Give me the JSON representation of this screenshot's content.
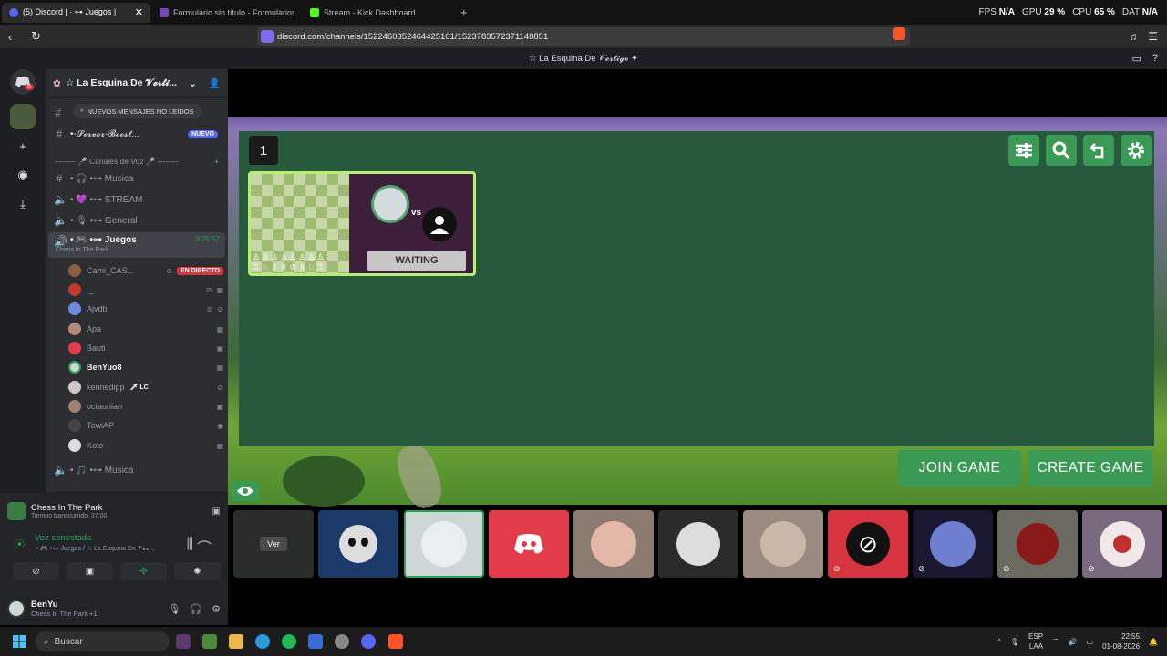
{
  "browser": {
    "tabs": [
      {
        "label": "(5) Discord | · ⊶ Juegos |",
        "favicon_color": "#5865f2"
      },
      {
        "label": "Formulario sin título - Formularios de",
        "favicon_color": "#7248b9"
      },
      {
        "label": "Stream - Kick Dashboard",
        "favicon_color": "#53fc18"
      }
    ],
    "new_tab": "+",
    "url": "discord.com/channels/1522460352464425101/1523783572371148851",
    "stats": {
      "fps_label": "FPS",
      "fps": "N/A",
      "gpu_label": "GPU",
      "gpu": "29 %",
      "cpu_label": "CPU",
      "cpu": "65 %",
      "dat_label": "DAT",
      "dat": "N/A"
    }
  },
  "window_title": "☆ La Esquina De 𝓥𝓮𝓻𝓽𝓲𝓰𝓮 ✦",
  "rail": {
    "badge": "5"
  },
  "server": {
    "name": "☆ La Esquina De 𝓥𝓮𝓻𝓽𝓲...",
    "unread_pill": "NUEVOS MENSAJES NO LEÍDOS",
    "text_channel": "•-𝓢𝓮𝓻𝓿𝓮𝓻-𝓑𝓸𝓸𝓼𝓽...",
    "nuevo": "NUEVO",
    "category": "-------- 🎤 Canales de Voz 🎤 --------",
    "category_plus": "+",
    "channels": [
      {
        "name": "• 🎧 •⊶ Musica"
      },
      {
        "name": "• 💜 •⊶ STREAM"
      },
      {
        "name": "• 🎙 •⊶ General"
      },
      {
        "name": "• 🎮 •⊶ Juegos",
        "time": "3:25:57",
        "activity": "Chess In The Park"
      }
    ],
    "users": [
      {
        "name": "Cami_CAS...",
        "live": "EN DIRECTO",
        "color": "#8b5e3c"
      },
      {
        "name": "._.",
        "color": "#c0392b"
      },
      {
        "name": "Ajvdb",
        "color": "#7289da"
      },
      {
        "name": "Apa",
        "color": "#b08a7a"
      },
      {
        "name": "Bauti",
        "color": "#e23c4a"
      },
      {
        "name": "BenYuo8",
        "color": "#cfd6d6"
      },
      {
        "name": "kennedipp",
        "tag": "🗡 LC",
        "color": "#d0c8c8"
      },
      {
        "name": "octaurilarr",
        "color": "#a08070"
      },
      {
        "name": "TowiAP",
        "color": "#444"
      },
      {
        "name": "Kote",
        "color": "#ddd"
      }
    ],
    "last_channel": "• 🎵 •⊶ Musica"
  },
  "panel": {
    "activity_title": "Chess In The Park",
    "activity_sub": "Tiempo transcurrido: 37:00",
    "voice_status": "Voz conectada",
    "voice_sub": "• 🎮 •⊶ Juegos / ☆ La Esquina De 𝓥𝓮𝓻...",
    "username": "BenYu",
    "user_status": "Chess In The Park +1"
  },
  "game": {
    "room_number": "1",
    "vs": "vs",
    "waiting": "WAITING",
    "join": "JOIN GAME",
    "create": "CREATE GAME",
    "ver": "Ver"
  },
  "taskbar": {
    "search": "Buscar",
    "lang": "ESP",
    "lang2": "LAA",
    "time": "22:55",
    "date": "01-08-2026"
  }
}
